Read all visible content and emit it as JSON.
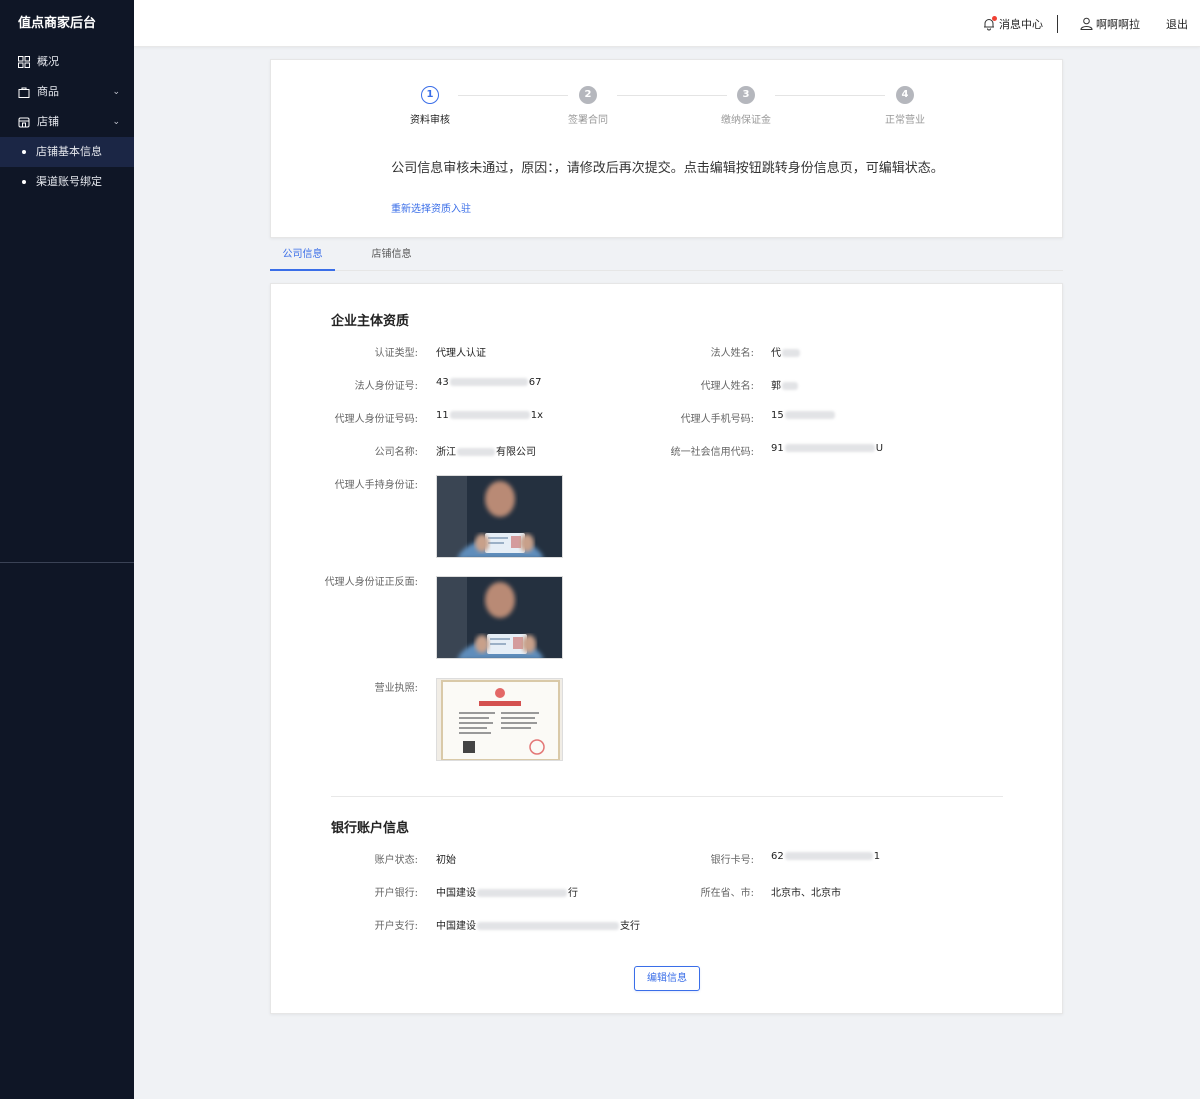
{
  "sidebar": {
    "brand": "值点商家后台",
    "items": [
      {
        "label": "概况",
        "icon": "grid-icon"
      },
      {
        "label": "商品",
        "icon": "bag-icon"
      },
      {
        "label": "店铺",
        "icon": "store-icon"
      }
    ],
    "subitems": [
      {
        "label": "店铺基本信息",
        "active": true
      },
      {
        "label": "渠道账号绑定",
        "active": false
      }
    ]
  },
  "header": {
    "messages": "消息中心",
    "username": "啊啊啊拉",
    "logout": "退出"
  },
  "steps": {
    "items": [
      {
        "num": "1",
        "label": "资料审核",
        "status": "active"
      },
      {
        "num": "2",
        "label": "签署合同",
        "status": "wait"
      },
      {
        "num": "3",
        "label": "缴纳保证金",
        "status": "wait"
      },
      {
        "num": "4",
        "label": "正常营业",
        "status": "wait"
      }
    ],
    "notice": "公司信息审核未通过，原因：，请修改后再次提交。点击编辑按钮跳转身份信息页，可编辑状态。",
    "reselect_link": "重新选择资质入驻"
  },
  "tabs": [
    {
      "label": "公司信息",
      "active": true
    },
    {
      "label": "店铺信息",
      "active": false
    }
  ],
  "company": {
    "section_title": "企业主体资质",
    "fields": {
      "cert_type_label": "认证类型:",
      "cert_type_value": "代理人认证",
      "legal_name_label": "法人姓名:",
      "legal_name_value": "代",
      "legal_id_label": "法人身份证号:",
      "legal_id_prefix": "43",
      "legal_id_suffix": "67",
      "agent_name_label": "代理人姓名:",
      "agent_name_value": "郭",
      "agent_id_label": "代理人身份证号码:",
      "agent_id_prefix": "11",
      "agent_id_suffix": "1x",
      "agent_phone_label": "代理人手机号码:",
      "agent_phone_prefix": "15",
      "company_name_label": "公司名称:",
      "company_name_prefix": "浙江",
      "company_name_suffix": "有限公司",
      "credit_code_label": "统一社会信用代码:",
      "credit_code_prefix": "91",
      "credit_code_suffix": "U",
      "agent_holding_id_label": "代理人手持身份证:",
      "agent_id_both_label": "代理人身份证正反面:",
      "license_label": "营业执照:"
    }
  },
  "bank": {
    "section_title": "银行账户信息",
    "fields": {
      "status_label": "账户状态:",
      "status_value": "初始",
      "card_label": "银行卡号:",
      "card_prefix": "62",
      "card_suffix": "1",
      "bank_label": "开户银行:",
      "bank_prefix": "中国建设",
      "bank_suffix": "行",
      "region_label": "所在省、市:",
      "region_value": "北京市、北京市",
      "branch_label": "开户支行:",
      "branch_prefix": "中国建设",
      "branch_suffix": "支行"
    }
  },
  "edit_button": "编辑信息",
  "colors": {
    "primary": "#3a6ee8",
    "sidebar_bg": "#0f1626",
    "sidebar_active": "#1b2645"
  }
}
